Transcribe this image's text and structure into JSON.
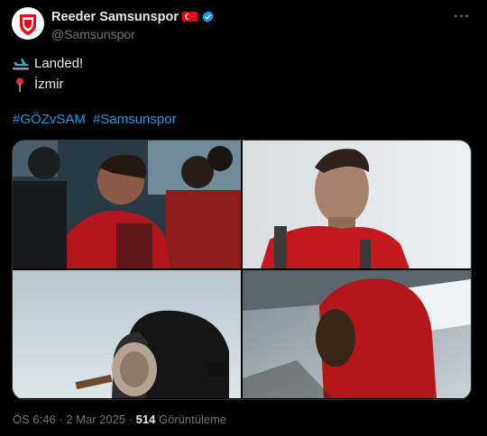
{
  "account": {
    "display_name": "Reeder Samsunspor",
    "handle": "@Samsunspor"
  },
  "post": {
    "line1_emoji": "plane-landing-icon",
    "line1": "Landed!",
    "line2_emoji": "pin-icon",
    "line2": "İzmir",
    "hashtags": [
      "#GÖZvSAM",
      "#Samsunspor"
    ]
  },
  "media": {
    "photos": [
      {
        "label": "photo-players-in-bus"
      },
      {
        "label": "photo-player-portrait"
      },
      {
        "label": "photo-headphones-closeup"
      },
      {
        "label": "photo-hooded-player"
      }
    ]
  },
  "meta": {
    "time": "ÖS 6:46",
    "sep1": "·",
    "date": "2 Mar 2025",
    "sep2": "·",
    "views_count": "514",
    "views_label": "Görüntüleme"
  },
  "colors": {
    "background": "#000000",
    "text": "#e7e9ea",
    "muted": "#71767b",
    "link": "#1d9bf0",
    "brand_red": "#e30a17"
  }
}
